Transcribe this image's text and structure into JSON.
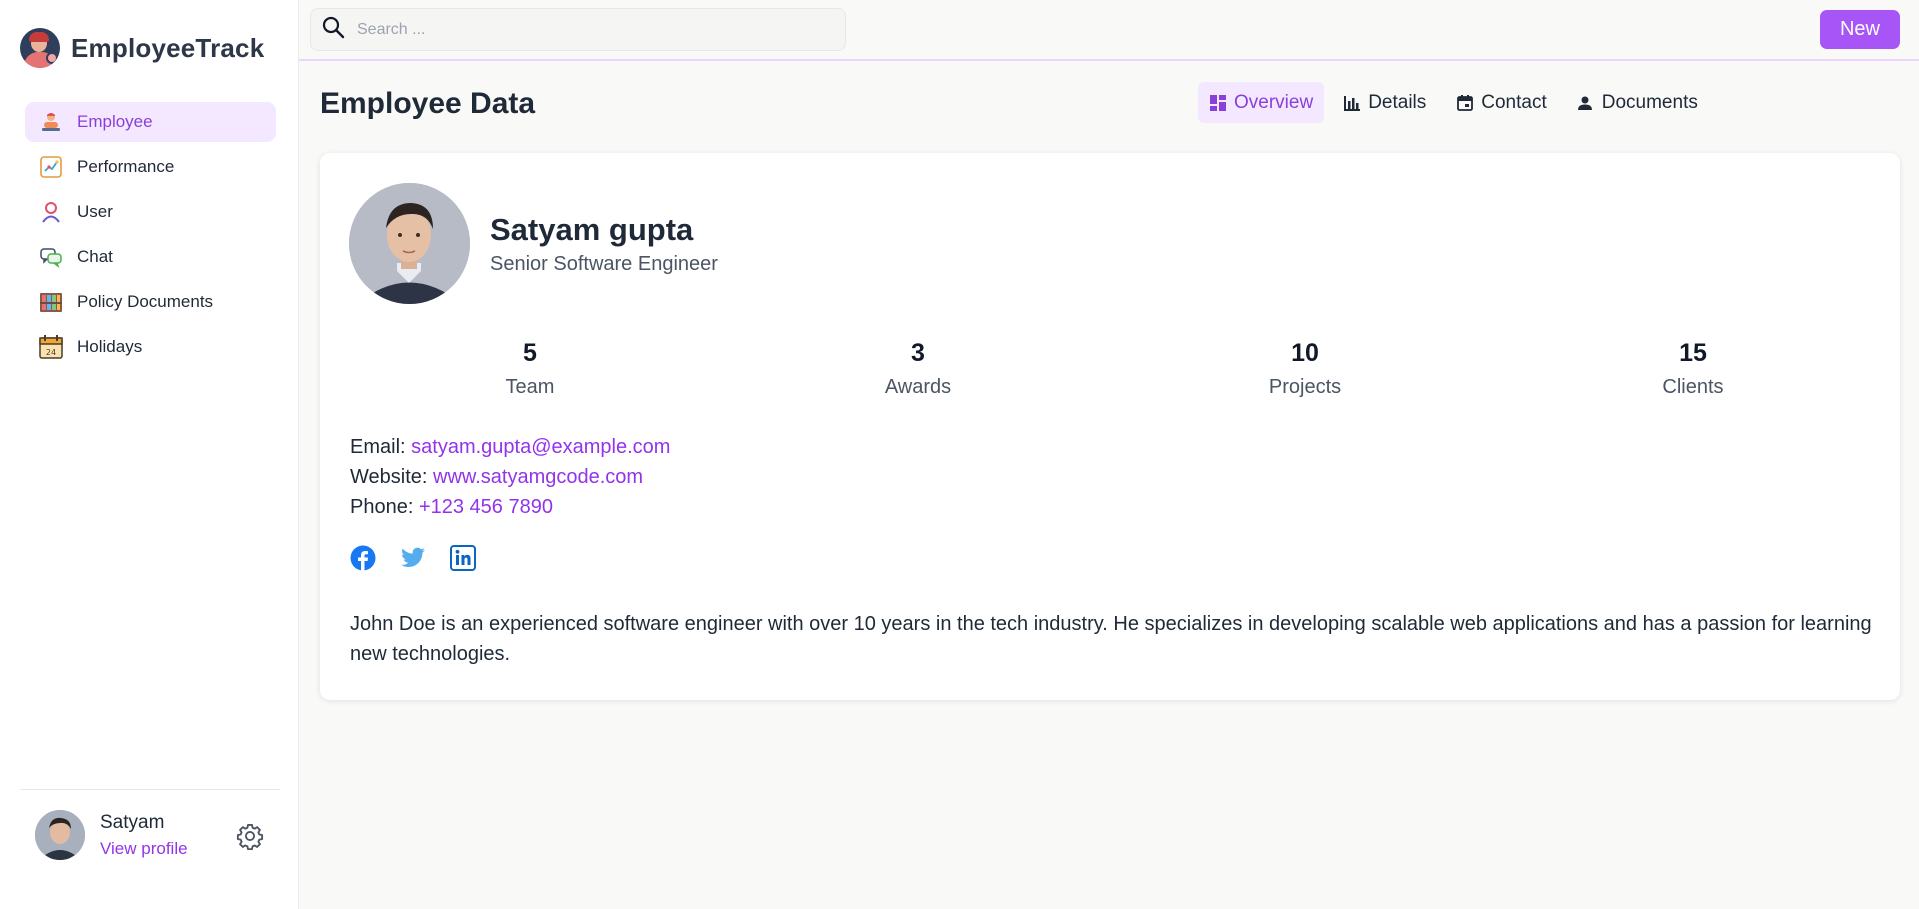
{
  "app": {
    "name": "EmployeeTrack"
  },
  "sidebar": {
    "items": [
      {
        "label": "Employee",
        "icon": "employee-icon",
        "active": true
      },
      {
        "label": "Performance",
        "icon": "performance-icon"
      },
      {
        "label": "User",
        "icon": "user-icon"
      },
      {
        "label": "Chat",
        "icon": "chat-icon"
      },
      {
        "label": "Policy Documents",
        "icon": "policy-documents-icon"
      },
      {
        "label": "Holidays",
        "icon": "calendar-icon"
      }
    ],
    "profile": {
      "name": "Satyam",
      "link": "View profile"
    }
  },
  "topbar": {
    "search_placeholder": "Search ...",
    "new_label": "New"
  },
  "main": {
    "title": "Employee Data",
    "tabs": [
      {
        "label": "Overview",
        "icon": "grid-icon",
        "active": true
      },
      {
        "label": "Details",
        "icon": "bar-chart-icon"
      },
      {
        "label": "Contact",
        "icon": "calendar-card-icon"
      },
      {
        "label": "Documents",
        "icon": "person-icon"
      }
    ]
  },
  "employee": {
    "name": "Satyam gupta",
    "role": "Senior Software Engineer",
    "stats": [
      {
        "value": "5",
        "label": "Team"
      },
      {
        "value": "3",
        "label": "Awards"
      },
      {
        "value": "10",
        "label": "Projects"
      },
      {
        "value": "15",
        "label": "Clients"
      }
    ],
    "contact": {
      "email_label": "Email:",
      "email": "satyam.gupta@example.com",
      "website_label": "Website:",
      "website": "www.satyamgcode.com",
      "phone_label": "Phone:",
      "phone": "+123 456 7890"
    },
    "bio": "John Doe is an experienced software engineer with over 10 years in the tech industry. He specializes in developing scalable web applications and has a passion for learning new technologies."
  },
  "colors": {
    "accent": "#a855f7",
    "accent_text": "#9333ea",
    "active_bg": "#f3e8ff",
    "facebook": "#1877f2",
    "twitter": "#55acee",
    "linkedin": "#0a66c2"
  }
}
